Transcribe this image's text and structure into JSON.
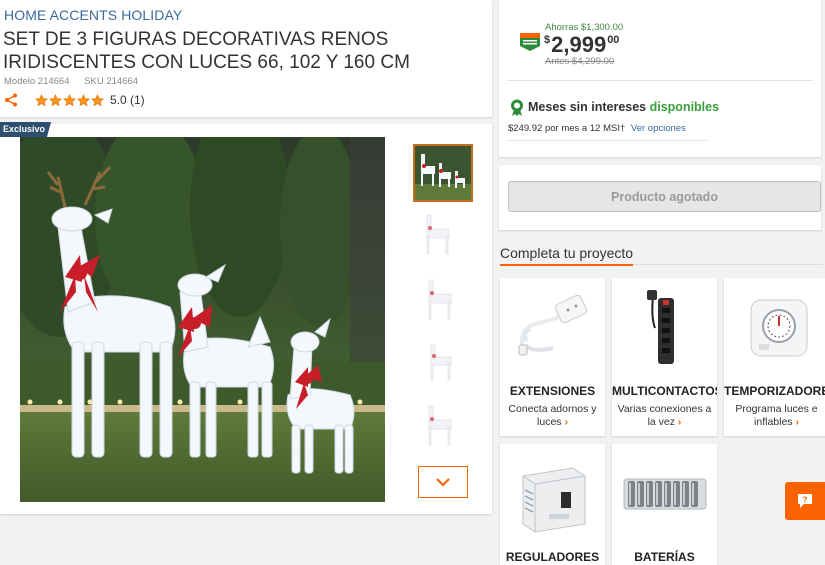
{
  "product": {
    "brand": "HOME ACCENTS HOLIDAY",
    "title": "SET DE 3 FIGURAS DECORATIVAS RENOS IRIDISCENTES CON LUCES 66, 102 Y 160 CM",
    "model": "Modelo 214664",
    "sku": "SKU 214664",
    "rating_value": 5,
    "rating_text": "5.0 (1)",
    "badge": "Exclusivo"
  },
  "price": {
    "savings": "Ahorras $1,300.00",
    "tag_icon": "precio-bajo-tag-icon",
    "currency": "$",
    "amount": "2,999",
    "cents": "00",
    "before": "Antes $4,299.00"
  },
  "msi": {
    "title": "Meses sin intereses",
    "available": "disponibles",
    "detail": "$249.92 por mes a 12 MSI†",
    "link": "Ver opciones"
  },
  "stock": {
    "button_label": "Producto agotado"
  },
  "project": {
    "heading": "Completa tu proyecto",
    "cards": [
      {
        "name": "EXTENSIONES",
        "desc": "Conecta adornos y luces",
        "icon": "extension-cord-icon"
      },
      {
        "name": "MULTICONTACTOS",
        "desc": "Varias conexiones a la vez",
        "icon": "power-strip-icon"
      },
      {
        "name": "TEMPORIZADORES",
        "desc": "Programa luces e inflables",
        "icon": "timer-icon"
      },
      {
        "name": "REGULADORES",
        "desc": "",
        "icon": "voltage-regulator-icon"
      },
      {
        "name": "BATERÍAS",
        "desc": "",
        "icon": "batteries-icon"
      }
    ]
  },
  "colors": {
    "accent": "#f96302",
    "link": "#3a6a9a",
    "green": "#3a9e3a"
  }
}
